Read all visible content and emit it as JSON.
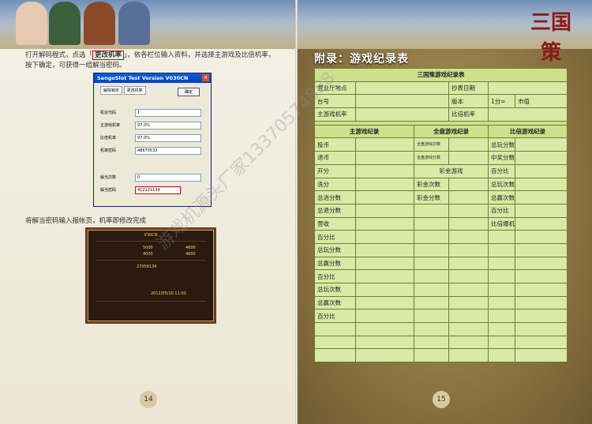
{
  "header": {
    "logo_text": "三国策"
  },
  "left_page": {
    "instruction_pre": "打开解码程式，点选「",
    "instruction_bold": "更改机率",
    "instruction_post": "」，依各栏位输入资料，并选择主游戏及比倍机率，按下确定，可获得一组解当密码。",
    "dialog": {
      "title": "SangoSlot Test Version V030CN",
      "tab1": "解除锁定",
      "tab2": "更改机率",
      "confirm_button": "确定",
      "fields": [
        {
          "label": "机台代码",
          "value": "1"
        },
        {
          "label": "主游戏机率",
          "value": "97.0%"
        },
        {
          "label": "比倍机率",
          "value": "97.0%"
        },
        {
          "label": "机率密码",
          "value": "48670533"
        },
        {
          "label": "解当次数",
          "value": "0"
        },
        {
          "label": "解当密码",
          "value": "412121134"
        }
      ]
    },
    "step2_text": "将解当密码输入报帐页，机率即修改完成",
    "game_screen": {
      "tag": "V30CN",
      "value1": "5000",
      "value2": "4000",
      "value3": "4600",
      "value4": "4600",
      "code": "27058134",
      "datetime": "2012/05/10 11:03"
    },
    "page_number": "14"
  },
  "right_page": {
    "title": "附录：游戏纪录表",
    "page_number": "15",
    "table": {
      "caption": "三国策游戏纪录表",
      "info_rows": [
        [
          "营业厅地点",
          "",
          "抄表日期",
          ""
        ],
        [
          "台号",
          "",
          "版本",
          "",
          "1分=",
          "市值"
        ],
        [
          "主游戏机率",
          "",
          "",
          "比倍机率",
          ""
        ]
      ],
      "section_headers": [
        "主游戏纪录",
        "全盘游戏纪录",
        "比倍游戏纪录"
      ],
      "main_col": [
        "投币",
        "退币",
        "开分",
        "洗分",
        "总进分数",
        "总退分数",
        "营收",
        "百分比",
        "总玩分数",
        "总赢分数",
        "百分比",
        "总玩次数",
        "总赢次数",
        "百分比"
      ],
      "full_col": [
        "全盘游戏次数",
        "全盘游戏分数"
      ],
      "jackpot_header": "彩金游戏",
      "jackpot_col": [
        "彩金次数",
        "彩金分数"
      ],
      "double_col": [
        "总玩分数",
        "中奖分数",
        "百分比",
        "总玩次数",
        "总赢次数",
        "百分比",
        "比倍爆机"
      ]
    }
  },
  "watermark": "游戏机源头厂家13370574888",
  "colors": {
    "table_bg": "#d9e9a6",
    "table_border": "#6c8030",
    "title_red": "#8a1a1a"
  }
}
